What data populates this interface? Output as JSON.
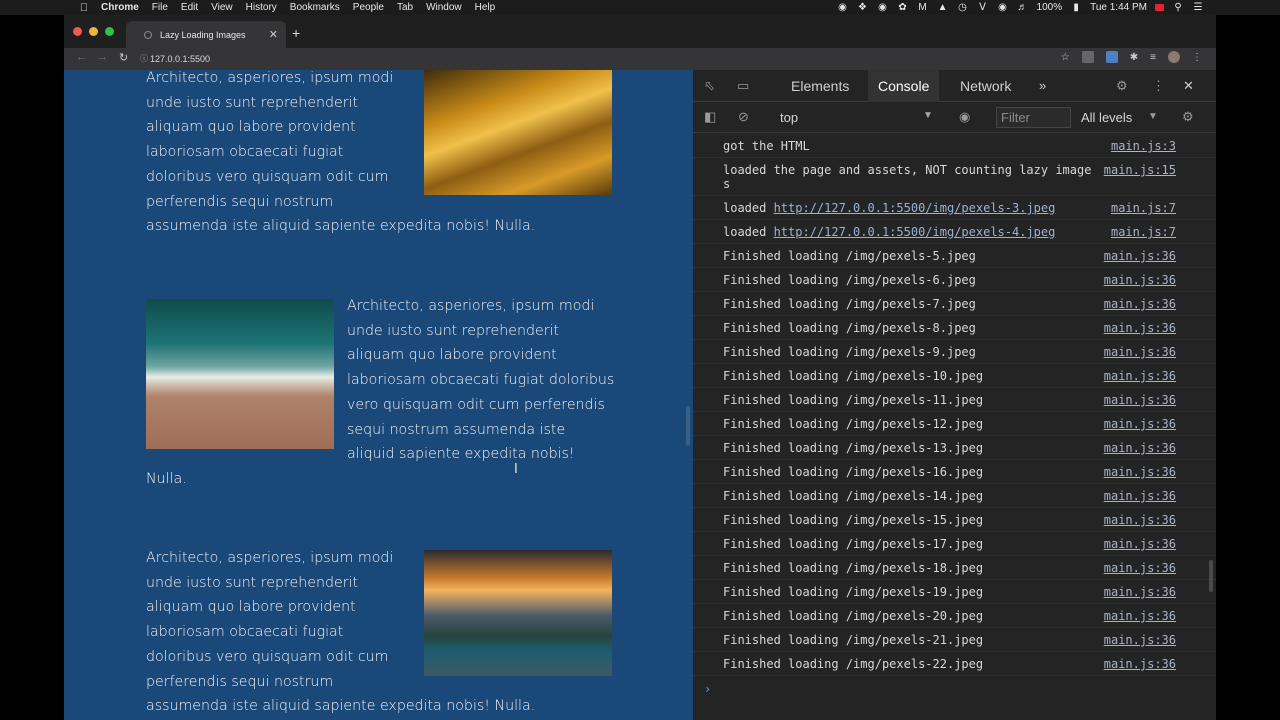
{
  "menubar": {
    "app": "Chrome",
    "menus": [
      "File",
      "Edit",
      "View",
      "History",
      "Bookmarks",
      "People",
      "Tab",
      "Window",
      "Help"
    ],
    "battery": "100%",
    "clock": "Tue 1:44 PM"
  },
  "browser": {
    "tab_title": "Lazy Loading Images",
    "url": "127.0.0.1:5500"
  },
  "page": {
    "articles": [
      {
        "text": "Architecto, asperiores, ipsum modi unde iusto sunt reprehenderit aliquam quo labore provident laboriosam obcaecati fugiat doloribus vero quisquam odit cum perferendis sequi nostrum assumenda iste aliquid sapiente expedita nobis! Nulla.",
        "image": "autumn-forest-image"
      },
      {
        "text": "Architecto, asperiores, ipsum modi unde iusto sunt reprehenderit aliquam quo labore provident laboriosam obcaecati fugiat doloribus vero quisquam odit cum perferendis sequi nostrum assumenda iste aliquid sapiente expedita nobis! Nulla.",
        "image": "beach-aerial-image"
      },
      {
        "text": "Architecto, asperiores, ipsum modi unde iusto sunt reprehenderit aliquam quo labore provident laboriosam obcaecati fugiat doloribus vero quisquam odit cum perferendis sequi nostrum assumenda iste aliquid sapiente expedita nobis! Nulla.",
        "image": "lake-dock-image"
      }
    ]
  },
  "devtools": {
    "tabs": [
      "Elements",
      "Console",
      "Network"
    ],
    "active_tab": "Console",
    "context": "top",
    "filter_placeholder": "Filter",
    "levels": "All levels",
    "logs": [
      {
        "msg": "got the HTML",
        "src": "main.js:3"
      },
      {
        "msg": "loaded the page and assets, NOT counting lazy images",
        "src": "main.js:15"
      },
      {
        "prefix": "loaded ",
        "link": "http://127.0.0.1:5500/img/pexels-3.jpeg",
        "src": "main.js:7"
      },
      {
        "prefix": "loaded ",
        "link": "http://127.0.0.1:5500/img/pexels-4.jpeg",
        "src": "main.js:7"
      },
      {
        "msg": "Finished loading /img/pexels-5.jpeg",
        "src": "main.js:36"
      },
      {
        "msg": "Finished loading /img/pexels-6.jpeg",
        "src": "main.js:36"
      },
      {
        "msg": "Finished loading /img/pexels-7.jpeg",
        "src": "main.js:36"
      },
      {
        "msg": "Finished loading /img/pexels-8.jpeg",
        "src": "main.js:36"
      },
      {
        "msg": "Finished loading /img/pexels-9.jpeg",
        "src": "main.js:36"
      },
      {
        "msg": "Finished loading /img/pexels-10.jpeg",
        "src": "main.js:36"
      },
      {
        "msg": "Finished loading /img/pexels-11.jpeg",
        "src": "main.js:36"
      },
      {
        "msg": "Finished loading /img/pexels-12.jpeg",
        "src": "main.js:36"
      },
      {
        "msg": "Finished loading /img/pexels-13.jpeg",
        "src": "main.js:36"
      },
      {
        "msg": "Finished loading /img/pexels-16.jpeg",
        "src": "main.js:36"
      },
      {
        "msg": "Finished loading /img/pexels-14.jpeg",
        "src": "main.js:36"
      },
      {
        "msg": "Finished loading /img/pexels-15.jpeg",
        "src": "main.js:36"
      },
      {
        "msg": "Finished loading /img/pexels-17.jpeg",
        "src": "main.js:36"
      },
      {
        "msg": "Finished loading /img/pexels-18.jpeg",
        "src": "main.js:36"
      },
      {
        "msg": "Finished loading /img/pexels-19.jpeg",
        "src": "main.js:36"
      },
      {
        "msg": "Finished loading /img/pexels-20.jpeg",
        "src": "main.js:36"
      },
      {
        "msg": "Finished loading /img/pexels-21.jpeg",
        "src": "main.js:36"
      },
      {
        "msg": "Finished loading /img/pexels-22.jpeg",
        "src": "main.js:36"
      }
    ]
  }
}
